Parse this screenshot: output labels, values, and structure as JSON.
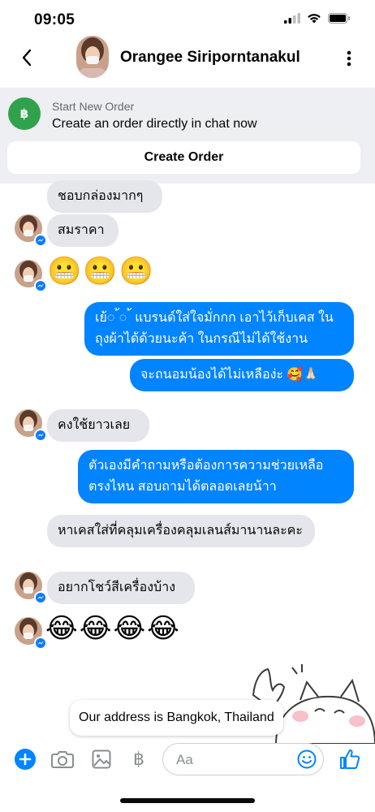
{
  "status_bar": {
    "time": "09:05"
  },
  "header": {
    "contact_name": "Orangee Siriporntanakul"
  },
  "order_banner": {
    "icon_symbol": "฿",
    "small_label": "Start New Order",
    "main_label": "Create an order directly in chat now",
    "button_label": "Create Order"
  },
  "messages": [
    {
      "text": "ชอบกล่องมากๆ",
      "direction": "incoming"
    },
    {
      "text": "สมราคา",
      "direction": "incoming"
    },
    {
      "text": "😬😬😬",
      "direction": "incoming"
    },
    {
      "text": "เย้◌ ้◌ ้ แบรนด์ใส่ใจมั่กกก เอาไว้เก็บเคส ในถุงผ้าได้ด้วยนะค้า ในกรณีไม่ได้ใช้งาน",
      "direction": "outgoing"
    },
    {
      "text": "จะถนอมน้องได้ไม่เหลือง่ะ 🥰🙏🏻",
      "direction": "outgoing"
    },
    {
      "text": "คงใช้ยาวเลย",
      "direction": "incoming"
    },
    {
      "text": "ตัวเองมีคำถามหรือต้องการความช่วยเหลือ ตรงไหน สอบถามได้ตลอดเลยน้าา",
      "direction": "outgoing"
    },
    {
      "text": "หาเคสใส่ที่คลุมเครื่องคลุมเลนส์มานานละคะ",
      "direction": "incoming"
    },
    {
      "text": "อยากโชว์สีเครื่องบ้าง",
      "direction": "incoming"
    },
    {
      "text": "😂😂😂😂",
      "direction": "incoming"
    }
  ],
  "tooltip": {
    "text": "Our address is Bangkok, Thailand"
  },
  "composer": {
    "placeholder": "Aa",
    "baht_symbol": "฿"
  },
  "colors": {
    "accent": "#0084ff",
    "incoming_bubble": "#e4e6eb",
    "banner_bg": "#eeeff3",
    "order_icon": "#31a24c"
  }
}
